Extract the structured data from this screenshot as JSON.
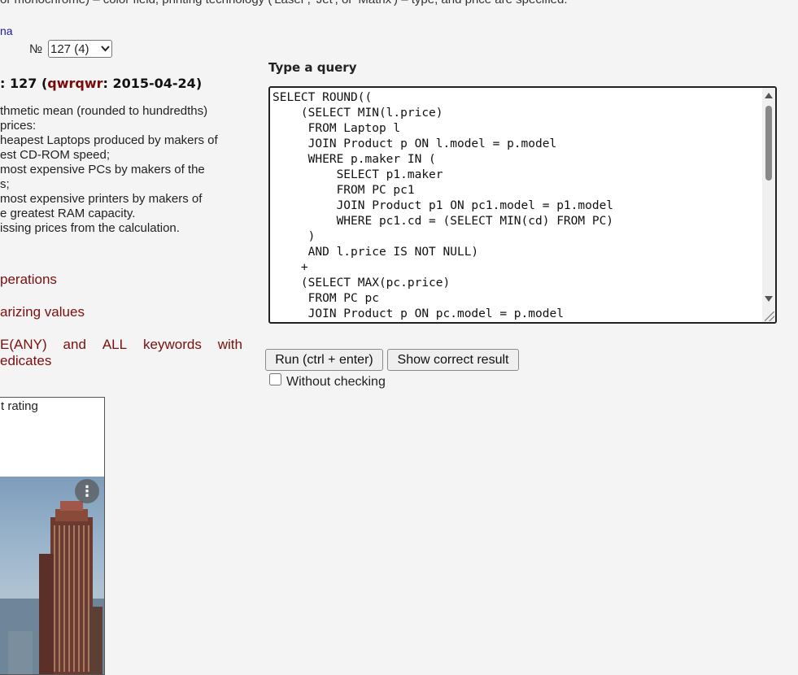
{
  "header": {
    "intro_text": "or monochrome) – color field, printing technology ('Laser', 'Jet', or 'Matrix') – type, and price are specified.",
    "link": "na"
  },
  "task_selector": {
    "label": "№",
    "selected": "127 (4)"
  },
  "task": {
    "heading_prefix": ": 127 (",
    "author": "qwrqwr",
    "heading_suffix": ": 2015-04-24)",
    "lines": [
      "thmetic mean (rounded to hundredths)",
      "prices:",
      "heapest Laptops produced by makers of",
      "est CD-ROM speed;",
      "most expensive PCs by makers of the",
      "s;",
      "most expensive printers by makers of",
      "e greatest RAM capacity.",
      "issing prices from the calculation."
    ]
  },
  "topics": {
    "t1": "perations",
    "t2": "arizing values",
    "t3_a": "E(ANY)",
    "t3_b": "and",
    "t3_c": "ALL",
    "t3_d": "keywords",
    "t3_e": "with",
    "t3_line2": "edicates"
  },
  "ad": {
    "caption": "t rating",
    "menu_glyph": "⋮"
  },
  "query": {
    "label": "Type a query",
    "text": "SELECT ROUND((\n    (SELECT MIN(l.price)\n     FROM Laptop l\n     JOIN Product p ON l.model = p.model\n     WHERE p.maker IN (\n         SELECT p1.maker\n         FROM PC pc1\n         JOIN Product p1 ON pc1.model = p1.model\n         WHERE pc1.cd = (SELECT MIN(cd) FROM PC)\n     )\n     AND l.price IS NOT NULL)\n    +\n    (SELECT MAX(pc.price)\n     FROM PC pc\n     JOIN Product p ON pc.model = p.model"
  },
  "actions": {
    "run_label": "Run (ctrl + enter)",
    "correct_label": "Show correct result",
    "nocheck_label": "Without checking"
  }
}
